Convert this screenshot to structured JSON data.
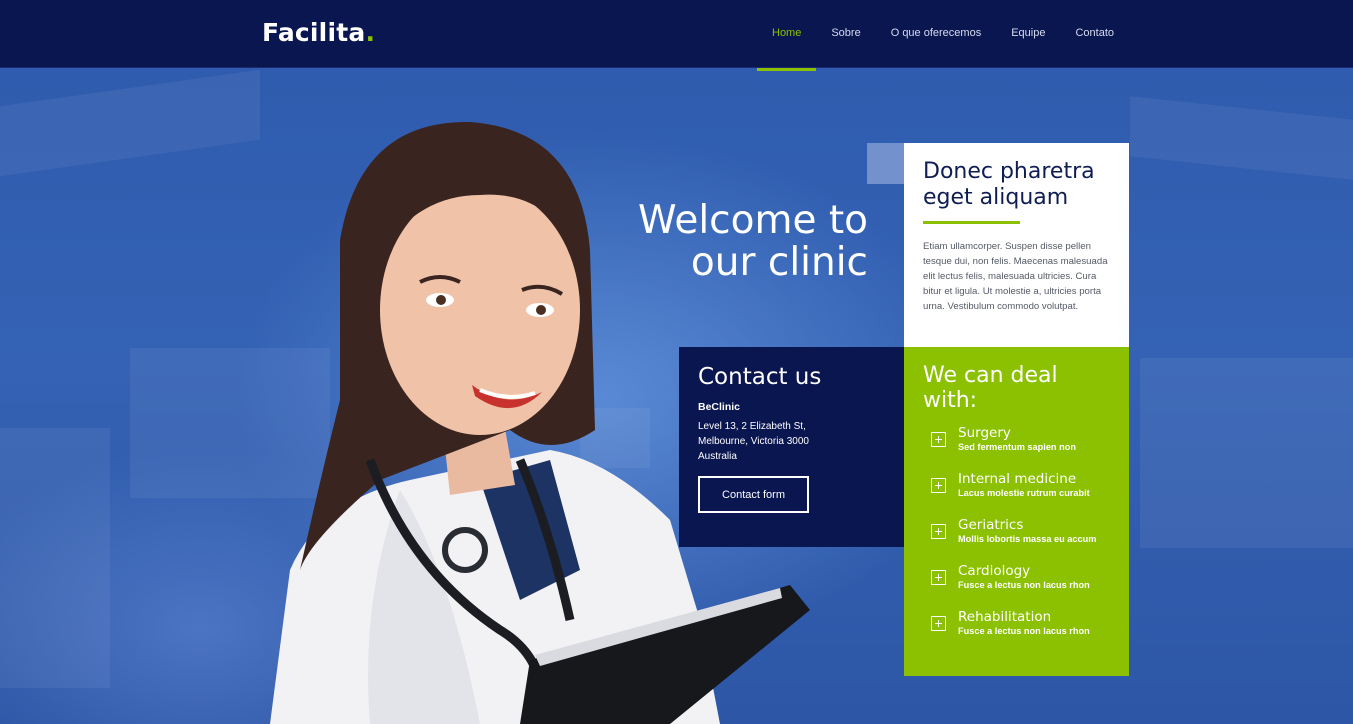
{
  "brand": {
    "name": "Facilita",
    "dot": ".",
    "accent_color": "#8bc100",
    "navy_color": "#0a1650"
  },
  "nav": {
    "items": [
      {
        "label": "Home",
        "active": true
      },
      {
        "label": "Sobre",
        "active": false
      },
      {
        "label": "O que oferecemos",
        "active": false
      },
      {
        "label": "Equipe",
        "active": false
      },
      {
        "label": "Contato",
        "active": false
      }
    ]
  },
  "hero": {
    "welcome_line1": "Welcome to",
    "welcome_line2": "our clinic"
  },
  "info_card": {
    "title": "Donec pharetra eget aliquam",
    "body": "Etiam ullamcorper. Suspen disse pellen tesque dui, non felis. Maecenas malesuada elit lectus felis, malesuada ultricies. Cura bitur et ligula. Ut molestie a, ultricies porta urna. Vestibulum commodo volutpat."
  },
  "contact": {
    "title": "Contact us",
    "org": "BeClinic",
    "address_line1": "Level 13, 2 Elizabeth St,",
    "address_line2": "Melbourne, Victoria 3000",
    "address_line3": "Australia",
    "button_label": "Contact form"
  },
  "services": {
    "title": "We can deal with:",
    "icon": "plus-square-icon",
    "items": [
      {
        "title": "Surgery",
        "subtitle": "Sed fermentum sapien non"
      },
      {
        "title": "Internal medicine",
        "subtitle": "Lacus molestie rutrum curabit"
      },
      {
        "title": "Geriatrics",
        "subtitle": "Mollis lobortis massa eu accum"
      },
      {
        "title": "Cardiology",
        "subtitle": "Fusce a lectus non lacus rhon"
      },
      {
        "title": "Rehabilitation",
        "subtitle": "Fusce a lectus non lacus rhon"
      }
    ]
  }
}
